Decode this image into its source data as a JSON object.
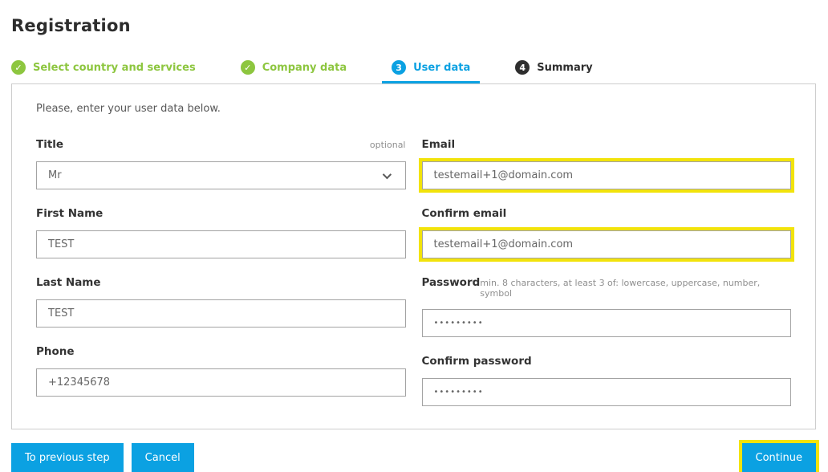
{
  "page": {
    "title": "Registration"
  },
  "steps": [
    {
      "label": "Select country and services",
      "symbol": "✓",
      "state": "completed"
    },
    {
      "label": "Company data",
      "symbol": "✓",
      "state": "completed"
    },
    {
      "label": "User data",
      "symbol": "3",
      "state": "active"
    },
    {
      "label": "Summary",
      "symbol": "4",
      "state": "upcoming"
    }
  ],
  "form": {
    "intro": "Please, enter your user data below.",
    "title": {
      "label": "Title",
      "note": "optional",
      "value": "Mr"
    },
    "first_name": {
      "label": "First Name",
      "value": "TEST"
    },
    "last_name": {
      "label": "Last Name",
      "value": "TEST"
    },
    "phone": {
      "label": "Phone",
      "value": "+12345678"
    },
    "email": {
      "label": "Email",
      "value": "testemail+1@domain.com"
    },
    "confirm_email": {
      "label": "Confirm email",
      "value": "testemail+1@domain.com"
    },
    "password": {
      "label": "Password",
      "hint": "min. 8 characters, at least 3 of: lowercase, uppercase, number, symbol",
      "value": "•••••••••"
    },
    "confirm_password": {
      "label": "Confirm password",
      "value": "•••••••••"
    }
  },
  "footer": {
    "prev_label": "To previous step",
    "cancel_label": "Cancel",
    "continue_label": "Continue"
  },
  "colors": {
    "accent_blue": "#0ba1e2",
    "success_green": "#8dc63f",
    "step_dark": "#2e2e2e",
    "highlight_yellow": "#f2e30b"
  }
}
